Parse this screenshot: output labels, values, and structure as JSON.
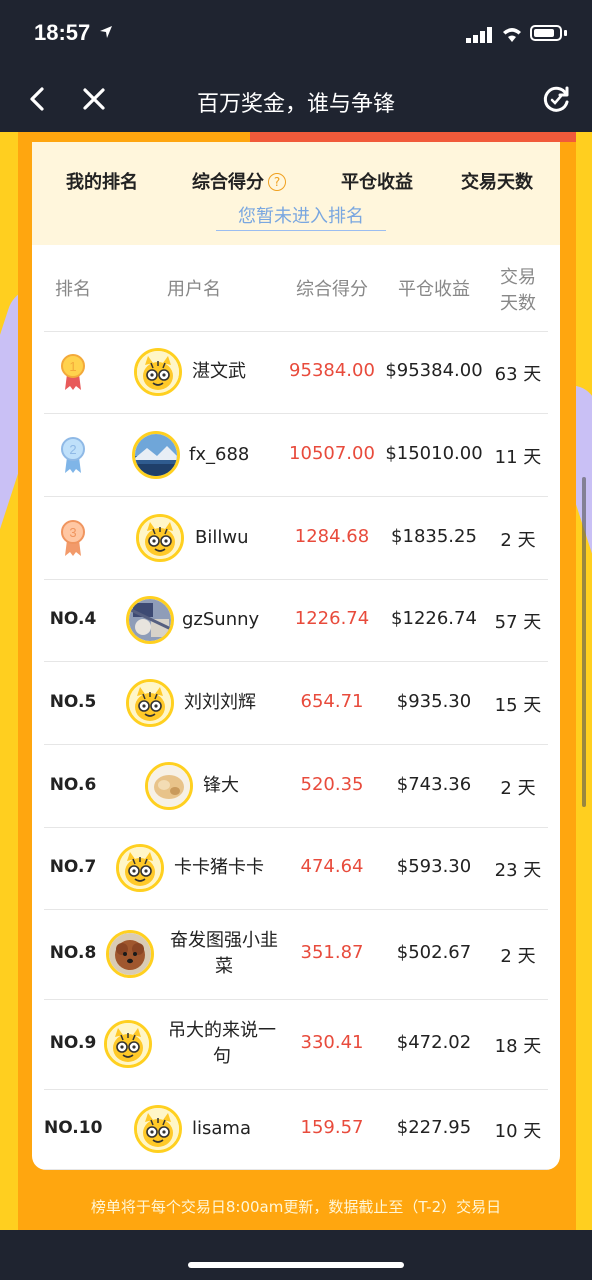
{
  "status": {
    "time": "18:57"
  },
  "nav": {
    "title": "百万奖金，谁与争锋"
  },
  "summary": {
    "my_rank": "我的排名",
    "score": "综合得分",
    "help": "?",
    "profit": "平仓收益",
    "days": "交易天数",
    "note": "您暂未进入排名"
  },
  "table": {
    "headers": {
      "rank": "排名",
      "user": "用户名",
      "score": "综合得分",
      "profit": "平仓收益",
      "days_line1": "交易",
      "days_line2": "天数"
    },
    "rows": [
      {
        "rank": "",
        "medal": "1",
        "name": "湛文武",
        "score": "95384.00",
        "profit": "$95384.00",
        "days": "63 天",
        "avatar": "tiger"
      },
      {
        "rank": "",
        "medal": "2",
        "name": "fx_688",
        "score": "10507.00",
        "profit": "$15010.00",
        "days": "11 天",
        "avatar": "landscape"
      },
      {
        "rank": "",
        "medal": "3",
        "name": "Billwu",
        "score": "1284.68",
        "profit": "$1835.25",
        "days": "2 天",
        "avatar": "tiger"
      },
      {
        "rank": "NO.4",
        "name": "gzSunny",
        "score": "1226.74",
        "profit": "$1226.74",
        "days": "57 天",
        "avatar": "photo"
      },
      {
        "rank": "NO.5",
        "name": "刘刘刘辉",
        "score": "654.71",
        "profit": "$935.30",
        "days": "15 天",
        "avatar": "tiger"
      },
      {
        "rank": "NO.6",
        "name": "锋大",
        "score": "520.35",
        "profit": "$743.36",
        "days": "2 天",
        "avatar": "bread"
      },
      {
        "rank": "NO.7",
        "name": "卡卡猪卡卡",
        "score": "474.64",
        "profit": "$593.30",
        "days": "23 天",
        "avatar": "tiger"
      },
      {
        "rank": "NO.8",
        "name": "奋发图强小韭",
        "name2": "菜",
        "score": "351.87",
        "profit": "$502.67",
        "days": "2 天",
        "avatar": "dog"
      },
      {
        "rank": "NO.9",
        "name": "吊大的来说一",
        "name2": "句",
        "score": "330.41",
        "profit": "$472.02",
        "days": "18 天",
        "avatar": "tiger"
      },
      {
        "rank": "NO.10",
        "name": "lisama",
        "score": "159.57",
        "profit": "$227.95",
        "days": "10 天",
        "avatar": "tiger"
      }
    ]
  },
  "footer_note": "榜单将于每个交易日8:00am更新，数据截止至（T-2）交易日",
  "colors": {
    "accent_orange": "#ffa60f",
    "yellow": "#ffcf1f",
    "score_red": "#e84b3c",
    "nav_bg": "#1f2430"
  }
}
